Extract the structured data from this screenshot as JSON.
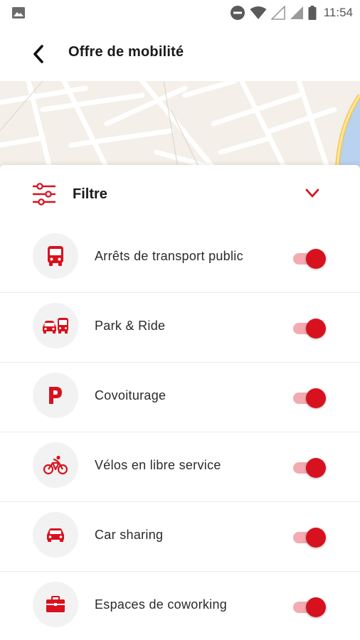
{
  "status_bar": {
    "time": "11:54",
    "icons": [
      "image-icon",
      "do-not-disturb-icon",
      "wifi-icon",
      "signal-icon",
      "signal-icon",
      "battery-icon"
    ]
  },
  "header": {
    "title": "Offre de mobilité",
    "back_icon": "back-arrow-icon"
  },
  "colors": {
    "accent": "#d7121e",
    "toggle_track": "#f3aab1",
    "icon_circle_bg": "#f2f2f2",
    "map_bg": "#f4efe8"
  },
  "filter": {
    "label": "Filtre",
    "icon": "sliders-icon",
    "expanded_icon": "chevron-down-icon"
  },
  "filters": [
    {
      "label": "Arrêts de transport public",
      "icon": "bus-icon",
      "enabled": true
    },
    {
      "label": "Park & Ride",
      "icon": "car-bus-icon",
      "enabled": true
    },
    {
      "label": "Covoiturage",
      "icon": "parking-icon",
      "enabled": true
    },
    {
      "label": "Vélos en libre service",
      "icon": "bicycle-icon",
      "enabled": true
    },
    {
      "label": "Car sharing",
      "icon": "car-icon",
      "enabled": true
    },
    {
      "label": "Espaces de coworking",
      "icon": "briefcase-icon",
      "enabled": true
    }
  ]
}
